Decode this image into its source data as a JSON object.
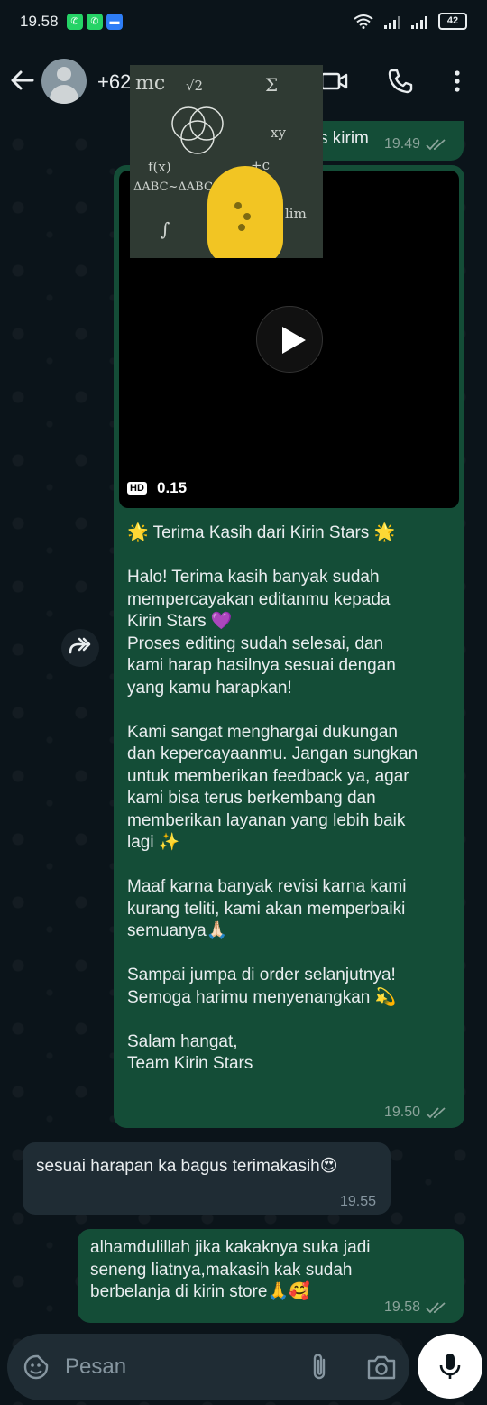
{
  "status_bar": {
    "time": "19.58",
    "battery": "42"
  },
  "header": {
    "contact_partial": "+62"
  },
  "sticker": {
    "formulas": [
      "mc",
      "√2",
      "Σ",
      "ΔABC~ΔABC",
      "xy",
      "lim",
      "f(x)",
      "∫",
      "+c"
    ]
  },
  "messages": [
    {
      "direction": "out",
      "partial_text": "s kirim",
      "time": "19.49"
    },
    {
      "direction": "out",
      "video": {
        "badge": "HD",
        "duration": "0.15"
      },
      "lines": [
        "🌟 Terima Kasih dari Kirin Stars 🌟",
        "",
        "Halo! Terima kasih banyak sudah",
        "mempercayakan editanmu kepada",
        "Kirin Stars 💜",
        "Proses editing sudah selesai, dan",
        "kami harap hasilnya sesuai dengan",
        "yang kamu harapkan!",
        "",
        "Kami sangat menghargai dukungan",
        "dan kepercayaanmu. Jangan sungkan",
        "untuk memberikan feedback ya, agar",
        "kami bisa terus berkembang dan",
        "memberikan layanan yang lebih baik",
        "lagi ✨",
        "",
        "Maaf karna banyak revisi karna kami",
        "kurang teliti, kami akan memperbaiki",
        "semuanya🙏🏻",
        "",
        "Sampai jumpa di order selanjutnya!",
        "Semoga harimu menyenangkan 💫",
        "",
        "Salam hangat,",
        "Team Kirin Stars"
      ],
      "time": "19.50"
    },
    {
      "direction": "in",
      "text": "sesuai harapan ka bagus terimakasih😍",
      "time": "19.55"
    },
    {
      "direction": "out",
      "lines": [
        "alhamdulillah jika kakaknya suka jadi",
        "seneng liatnya,makasih kak sudah",
        "berbelanja di kirin store🙏🥰"
      ],
      "time": "19.58"
    }
  ],
  "input": {
    "placeholder": "Pesan"
  },
  "colors": {
    "outgoing_bubble": "#144d37",
    "incoming_bubble": "#1f2c34",
    "background": "#0b141a",
    "ticks": "#8aa39a"
  }
}
